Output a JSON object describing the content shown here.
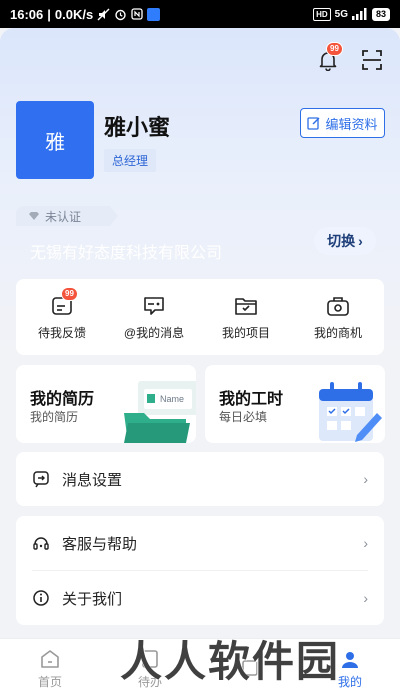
{
  "status_bar": {
    "time": "16:06",
    "speed": "0.0K/s",
    "network": "5G",
    "battery": "83",
    "hd": "HD"
  },
  "header": {
    "notification_badge": "99"
  },
  "profile": {
    "avatar_text": "雅",
    "name": "雅小蜜",
    "role": "总经理",
    "edit_label": "编辑资料"
  },
  "company": {
    "cert_status": "未认证",
    "name": "无锡有好态度科技有限公司",
    "switch_label": "切换"
  },
  "quick_actions": [
    {
      "label": "待我反馈",
      "icon": "feedback-icon",
      "badge": "99"
    },
    {
      "label": "@我的消息",
      "icon": "message-icon",
      "badge": ""
    },
    {
      "label": "我的项目",
      "icon": "project-icon",
      "badge": ""
    },
    {
      "label": "我的商机",
      "icon": "opportunity-icon",
      "badge": ""
    }
  ],
  "tiles": {
    "resume": {
      "title": "我的简历",
      "subtitle": "我的简历",
      "illustration_text": "Name"
    },
    "hours": {
      "title": "我的工时",
      "subtitle": "每日必填"
    }
  },
  "menu": {
    "message_settings": "消息设置",
    "support": "客服与帮助",
    "about": "关于我们"
  },
  "tabbar": {
    "home": "首页",
    "tab2": "待办",
    "tab4": "我的"
  },
  "watermark": "人人软件园",
  "colors": {
    "primary": "#2e6fe8",
    "badge": "#f4543b"
  }
}
